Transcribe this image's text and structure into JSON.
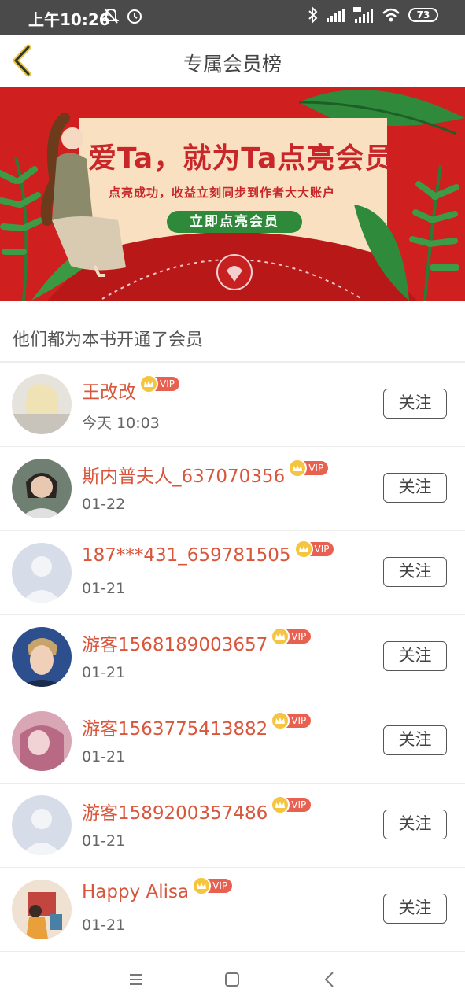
{
  "status_bar": {
    "time": "上午10:26",
    "battery": "73"
  },
  "navbar": {
    "title": "专属会员榜"
  },
  "banner": {
    "title": "爱Ta，就为Ta点亮会员",
    "subtitle": "点亮成功，收益立刻同步到作者大大账户",
    "button": "立即点亮会员"
  },
  "section_title": "他们都为本书开通了会员",
  "members": [
    {
      "name": "王改改",
      "badge": "VIP",
      "date": "今天 10:03",
      "follow": "关注",
      "avatar": "photo-blonde"
    },
    {
      "name": "斯内普夫人_637070356",
      "badge": "VIP",
      "date": "01-22",
      "follow": "关注",
      "avatar": "photo-girl"
    },
    {
      "name": "187***431_659781505",
      "badge": "VIP",
      "date": "01-21",
      "follow": "关注",
      "avatar": "default"
    },
    {
      "name": "游客1568189003657",
      "badge": "VIP",
      "date": "01-21",
      "follow": "关注",
      "avatar": "photo-man"
    },
    {
      "name": "游客1563775413882",
      "badge": "VIP",
      "date": "01-21",
      "follow": "关注",
      "avatar": "photo-pink"
    },
    {
      "name": "游客1589200357486",
      "badge": "VIP",
      "date": "01-21",
      "follow": "关注",
      "avatar": "default"
    },
    {
      "name": "Happy Alisa",
      "badge": "VIP",
      "date": "01-21",
      "follow": "关注",
      "avatar": "illustration"
    }
  ],
  "colors": {
    "accent": "#d9553b",
    "banner_red": "#cf1f1f",
    "vip_badge": "#e86050"
  }
}
